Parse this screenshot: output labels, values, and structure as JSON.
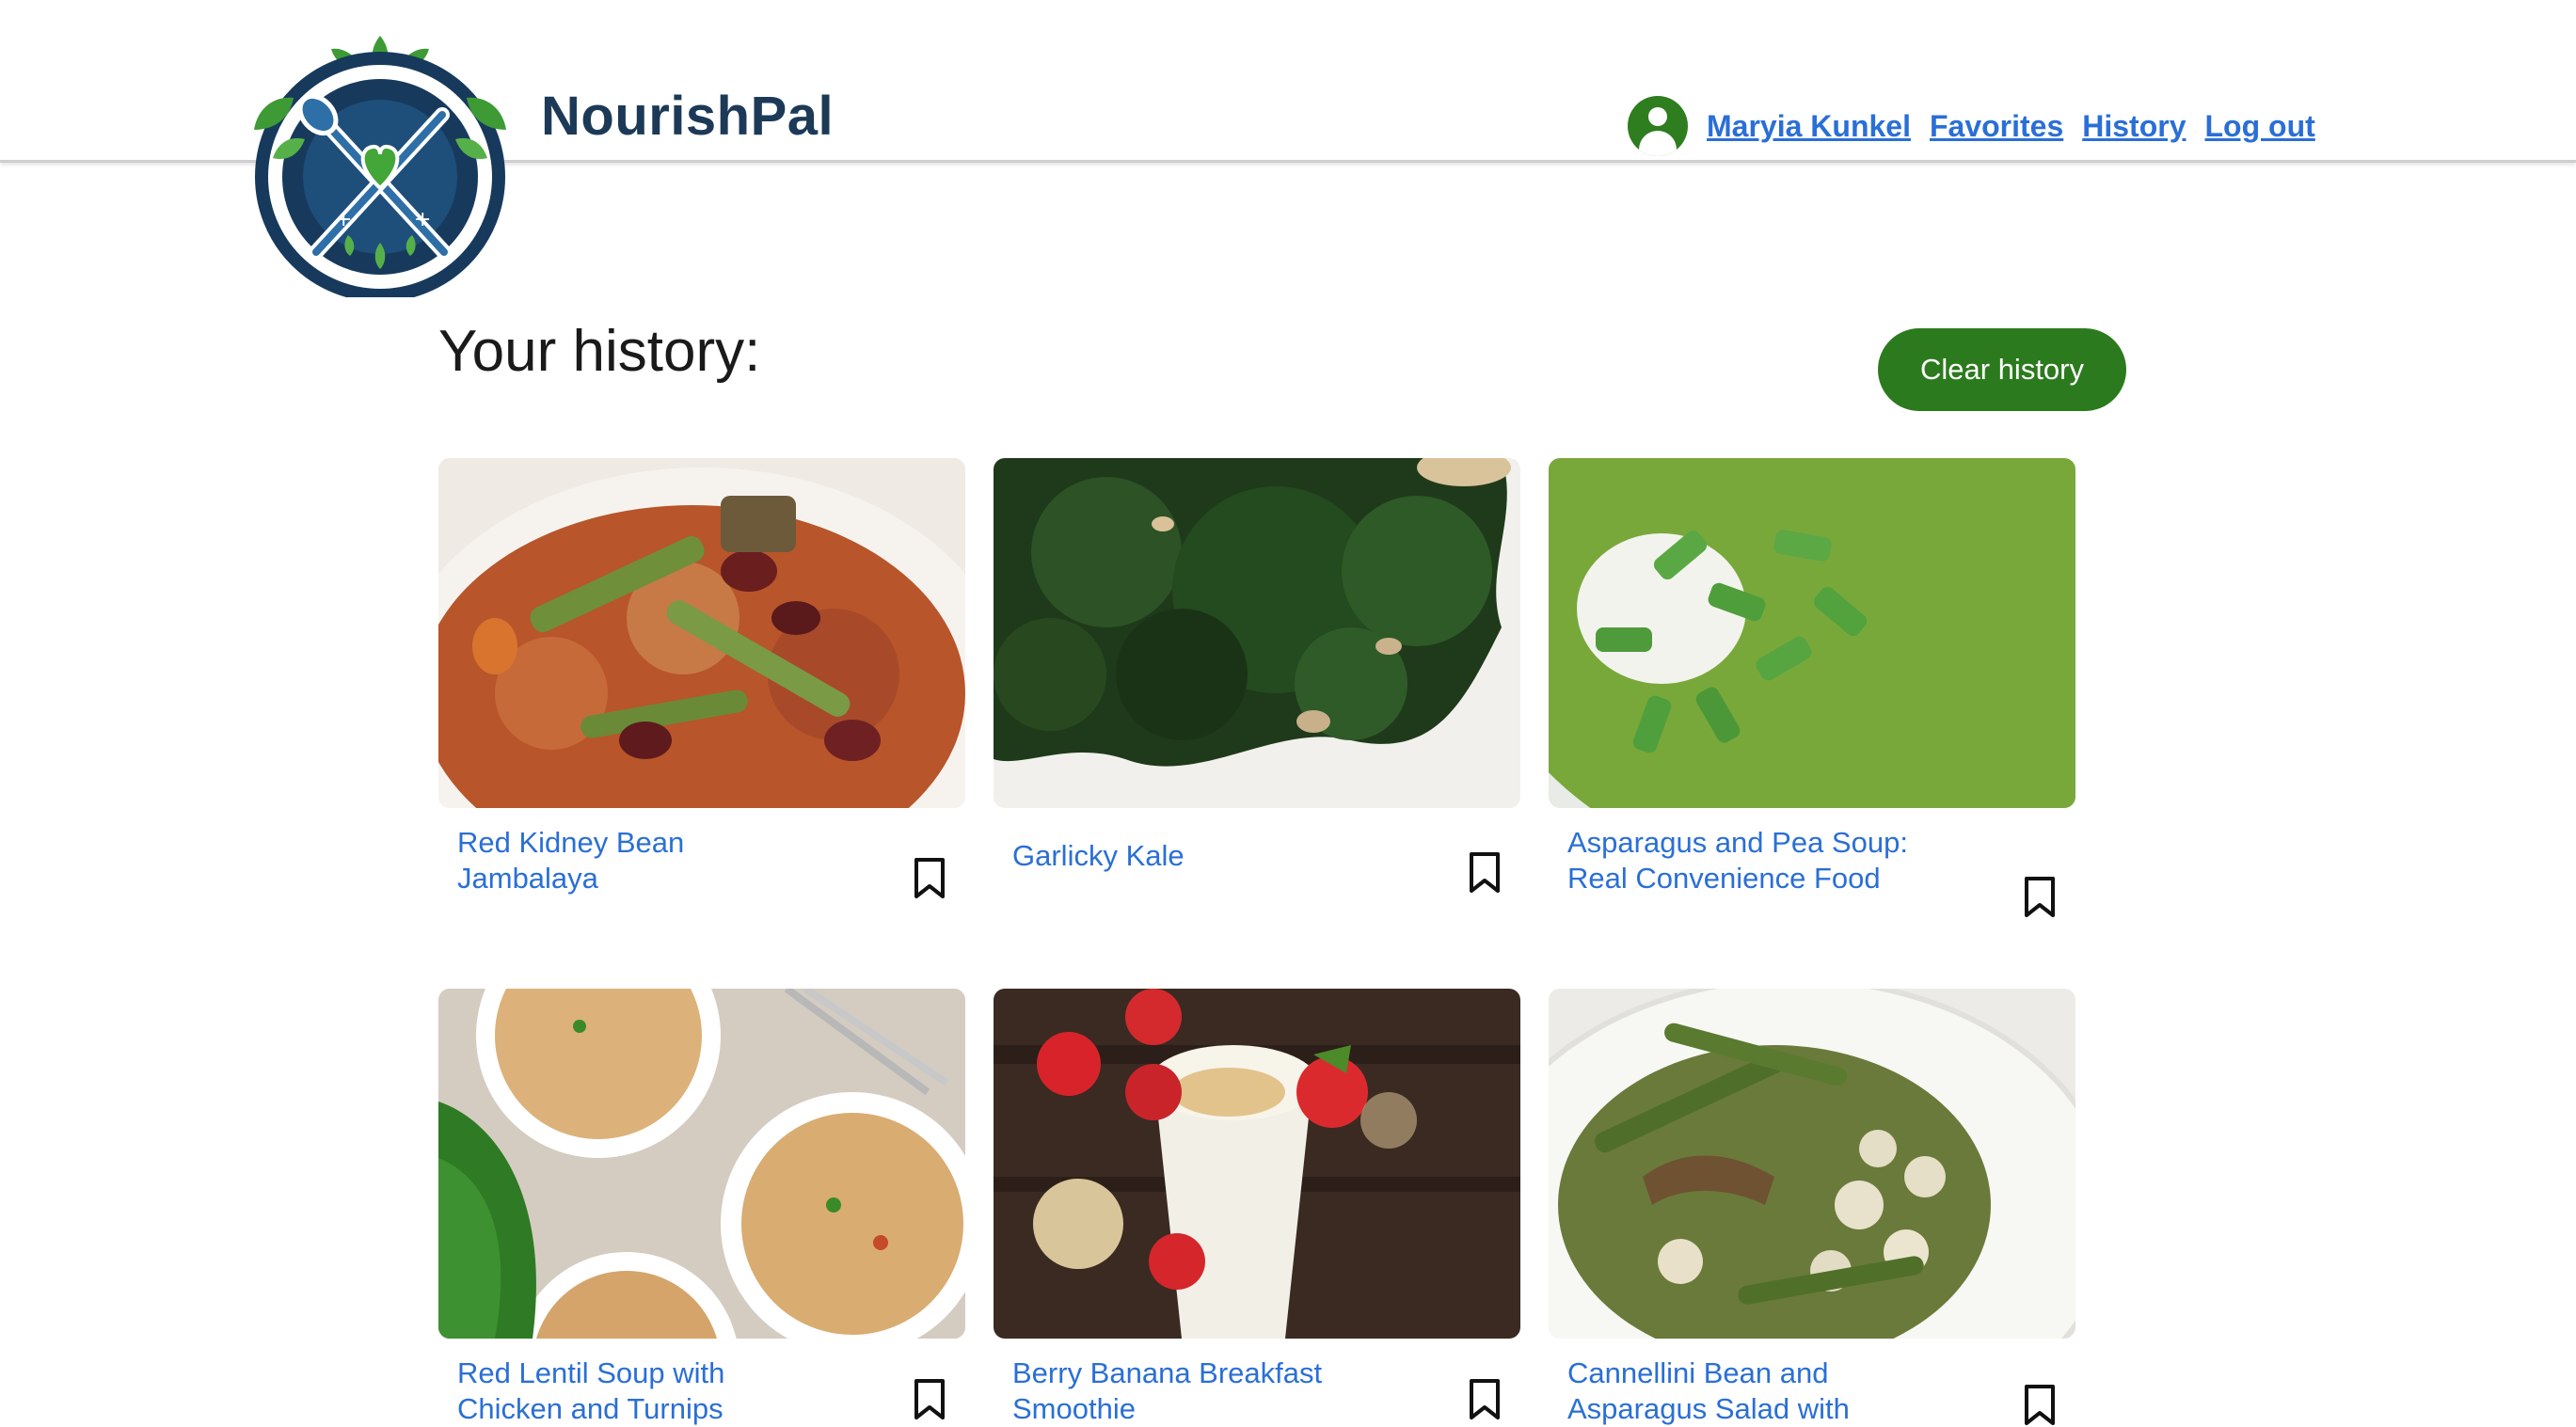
{
  "header": {
    "brand": "NourishPal",
    "user_name": "Maryia Kunkel",
    "nav": {
      "favorites": "Favorites",
      "history": "History",
      "logout": "Log out"
    }
  },
  "main": {
    "title": "Your history:",
    "clear_button": "Clear history"
  },
  "recipes": [
    {
      "title": "Red Kidney Bean Jambalaya",
      "image": "red kidney bean jambalaya photo"
    },
    {
      "title": "Garlicky Kale",
      "image": "garlicky kale photo"
    },
    {
      "title": "Asparagus and Pea Soup: Real Convenience Food",
      "image": "asparagus and pea soup photo"
    },
    {
      "title": "Red Lentil Soup with Chicken and Turnips",
      "image": "red lentil soup photo"
    },
    {
      "title": "Berry Banana Breakfast Smoothie",
      "image": "berry banana smoothie photo"
    },
    {
      "title": "Cannellini Bean and Asparagus Salad with",
      "image": "cannellini bean asparagus salad photo"
    }
  ],
  "colors": {
    "brand_text": "#1c3a57",
    "link": "#2a6fd6",
    "accent_green": "#2c7a1e"
  },
  "icons": {
    "user": "user-circle-icon",
    "bookmark": "bookmark-outline-icon"
  }
}
